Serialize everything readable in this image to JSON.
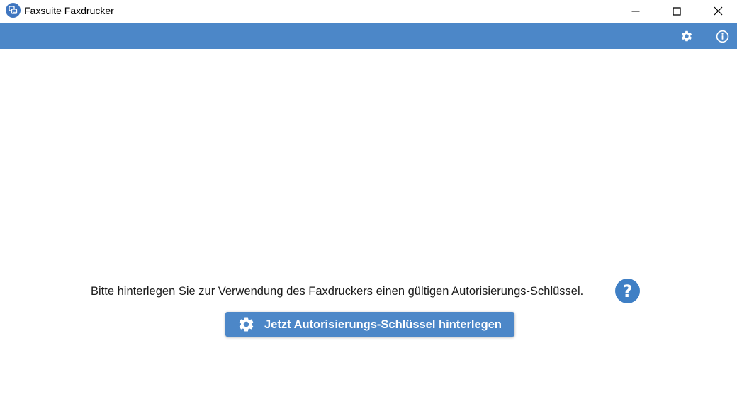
{
  "window": {
    "title": "Faxsuite Faxdrucker",
    "controls": {
      "minimize_icon": "minimize-icon",
      "maximize_icon": "maximize-icon",
      "close_icon": "close-icon"
    }
  },
  "toolbar": {
    "background": "#4c87c8",
    "icons": [
      "gear-icon",
      "info-icon"
    ]
  },
  "main": {
    "message": "Bitte hinterlegen Sie zur Verwendung des Faxdruckers einen gültigen Autorisierungs-Schlüssel.",
    "help_glyph": "?",
    "button_label": "Jetzt Autorisierungs-Schlüssel hinterlegen"
  },
  "colors": {
    "accent": "#4c87c8",
    "help": "#3f7fc5",
    "text": "#1a1a1a"
  }
}
